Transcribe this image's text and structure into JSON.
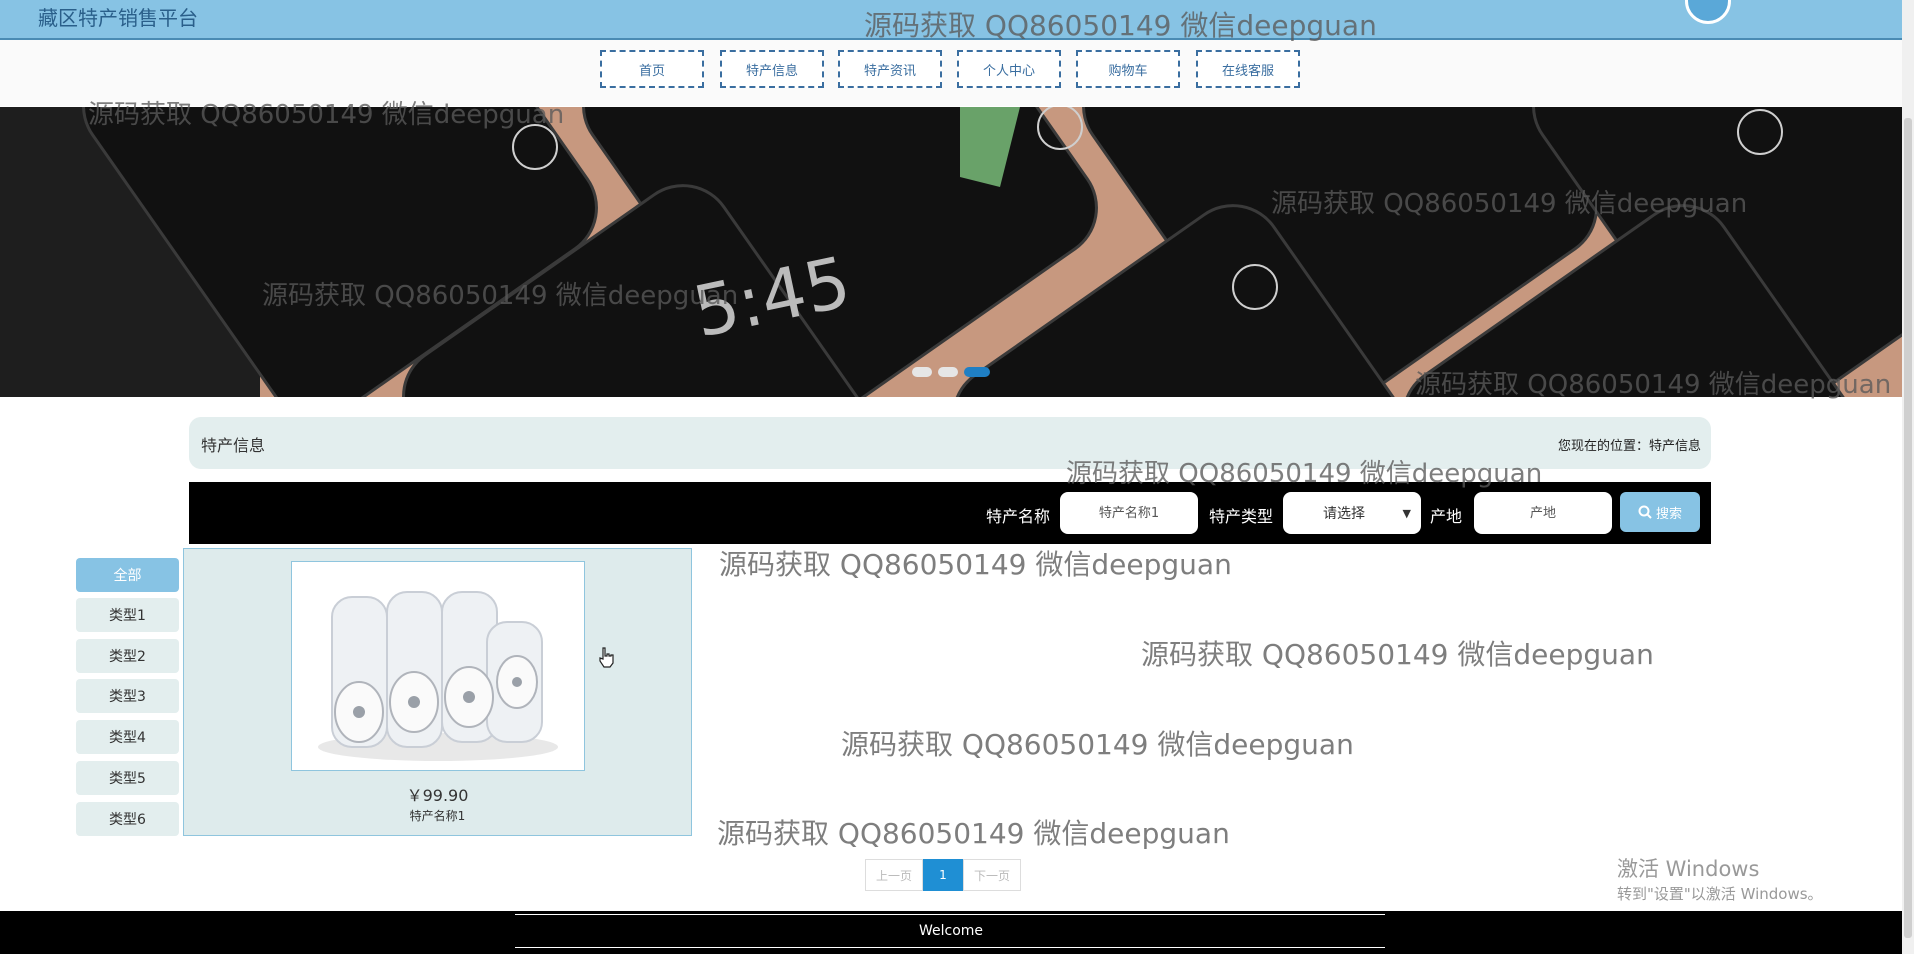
{
  "site": {
    "title": "藏区特产销售平台"
  },
  "nav": {
    "items": [
      "首页",
      "特产信息",
      "特产资讯",
      "个人中心",
      "购物车",
      "在线客服"
    ]
  },
  "banner": {
    "slide_count": 3,
    "active_slide": 3
  },
  "section": {
    "title": "特产信息",
    "breadcrumb": "您现在的位置：特产信息"
  },
  "search": {
    "name_label": "特产名称",
    "name_placeholder": "特产名称1",
    "type_label": "特产类型",
    "type_selected": "请选择",
    "origin_label": "产地",
    "origin_placeholder": "产地",
    "button_label": "搜索"
  },
  "categories": [
    "全部",
    "类型1",
    "类型2",
    "类型3",
    "类型4",
    "类型5",
    "类型6"
  ],
  "products": [
    {
      "price": "￥99.90",
      "name": "特产名称1"
    }
  ],
  "pagination": {
    "prev": "上一页",
    "current": "1",
    "next": "下一页"
  },
  "footer": {
    "text": "Welcome"
  },
  "watermark": {
    "text": "源码获取 QQ86050149 微信deepguan"
  },
  "os_notice": {
    "title": "激活 Windows",
    "subtitle": "转到\"设置\"以激活 Windows。"
  },
  "colors": {
    "accent": "#87c3e4",
    "nav_border": "#3a6ea0",
    "panel_bg": "#deebec",
    "page_active": "#1f8fd4"
  }
}
